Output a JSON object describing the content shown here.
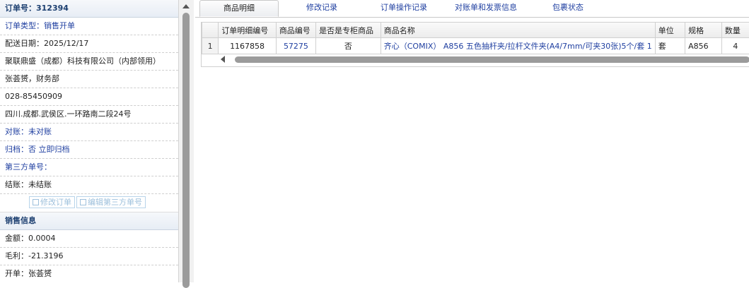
{
  "order": {
    "header": "订单号：312394",
    "rows": [
      {
        "text": "订单类型：销售开单",
        "blue": true
      },
      {
        "text": "配送日期：2025/12/17",
        "blue": false
      },
      {
        "text": "聚联鼎盛（成都）科技有限公司（内部领用）",
        "blue": false
      },
      {
        "text": "张荟赟，财务部",
        "blue": false
      },
      {
        "text": "028-85450909",
        "blue": false
      },
      {
        "text": "四川.成都.武侯区.一环路南二段24号",
        "blue": false
      },
      {
        "text": "对账：未对账",
        "blue": true
      },
      {
        "text": "归档：否 立即归档",
        "blue": true
      },
      {
        "text": "第三方单号：",
        "blue": true
      },
      {
        "text": "结账：未结账",
        "blue": false
      }
    ],
    "buttons": {
      "edit_order": "修改订单",
      "edit_third_party": "编辑第三方单号"
    }
  },
  "sales": {
    "header": "销售信息",
    "rows": [
      {
        "text": "金额：0.0004"
      },
      {
        "text": "毛利：-21.3196"
      },
      {
        "text": "开单：张荟赟"
      }
    ]
  },
  "tabs": [
    "商品明细",
    "修改记录",
    "订单操作记录",
    "对账单和发票信息",
    "包裹状态"
  ],
  "active_tab": 0,
  "grid": {
    "columns": [
      "订单明细编号",
      "商品编号",
      "是否是专柜商品",
      "商品名称",
      "单位",
      "规格",
      "数量"
    ],
    "rows": [
      {
        "index": "1",
        "detail_id": "1167858",
        "product_id": "57275",
        "is_counter": "否",
        "name": "齐心（COMIX） A856 五色抽杆夹/拉杆文件夹(A4/7mm/可夹30张)5个/套 1",
        "unit": "套",
        "spec": "A856",
        "qty": "4"
      }
    ]
  },
  "colors": {
    "link": "#1f3fa0",
    "header": "#1c3f70"
  }
}
